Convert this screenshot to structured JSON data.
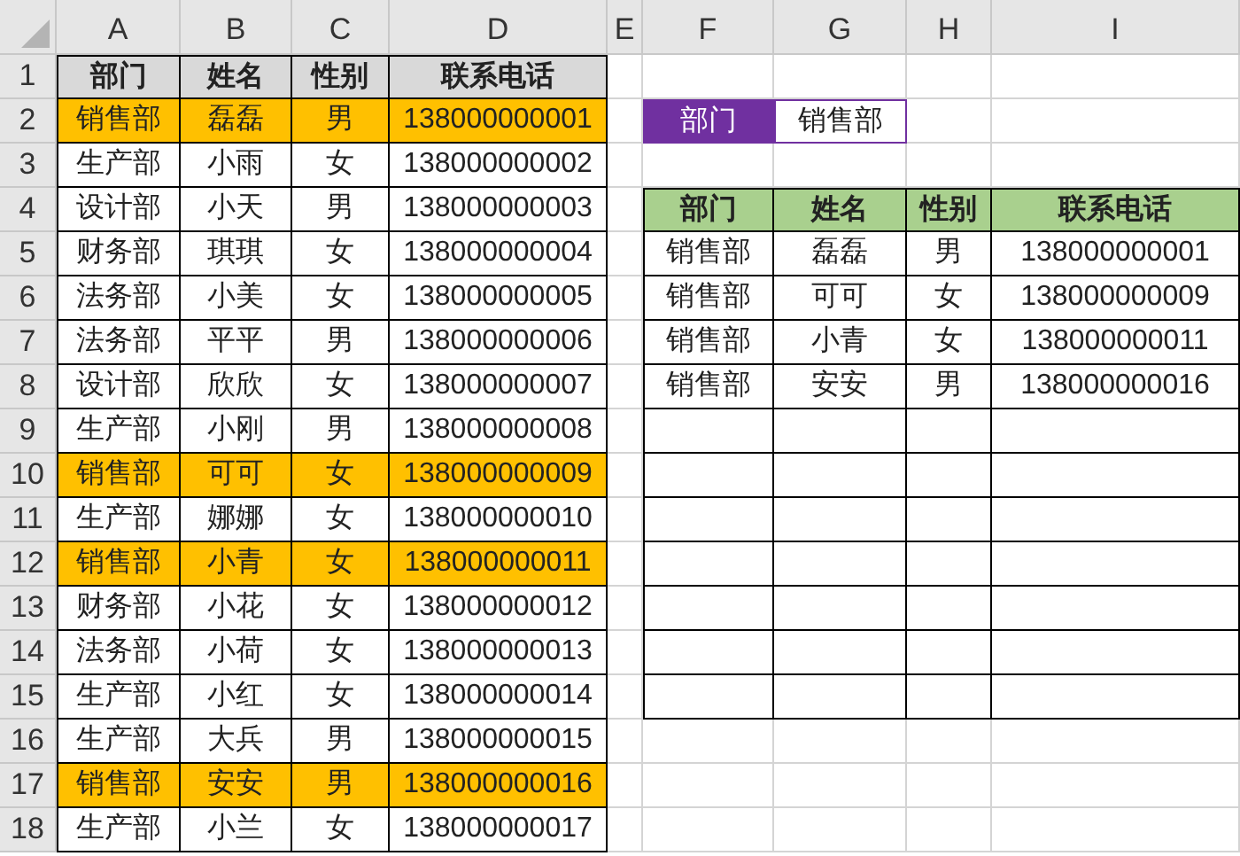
{
  "column_headers": [
    "A",
    "B",
    "C",
    "D",
    "E",
    "F",
    "G",
    "H",
    "I"
  ],
  "row_numbers": [
    "1",
    "2",
    "3",
    "4",
    "5",
    "6",
    "7",
    "8",
    "9",
    "10",
    "11",
    "12",
    "13",
    "14",
    "15",
    "16",
    "17",
    "18"
  ],
  "source_table": {
    "columns": [
      "部门",
      "姓名",
      "性别",
      "联系电话"
    ],
    "rows": [
      {
        "cells": [
          "销售部",
          "磊磊",
          "男",
          "138000000001"
        ],
        "highlighted": true
      },
      {
        "cells": [
          "生产部",
          "小雨",
          "女",
          "138000000002"
        ],
        "highlighted": false
      },
      {
        "cells": [
          "设计部",
          "小天",
          "男",
          "138000000003"
        ],
        "highlighted": false
      },
      {
        "cells": [
          "财务部",
          "琪琪",
          "女",
          "138000000004"
        ],
        "highlighted": false
      },
      {
        "cells": [
          "法务部",
          "小美",
          "女",
          "138000000005"
        ],
        "highlighted": false
      },
      {
        "cells": [
          "法务部",
          "平平",
          "男",
          "138000000006"
        ],
        "highlighted": false
      },
      {
        "cells": [
          "设计部",
          "欣欣",
          "女",
          "138000000007"
        ],
        "highlighted": false
      },
      {
        "cells": [
          "生产部",
          "小刚",
          "男",
          "138000000008"
        ],
        "highlighted": false
      },
      {
        "cells": [
          "销售部",
          "可可",
          "女",
          "138000000009"
        ],
        "highlighted": true
      },
      {
        "cells": [
          "生产部",
          "娜娜",
          "女",
          "138000000010"
        ],
        "highlighted": false
      },
      {
        "cells": [
          "销售部",
          "小青",
          "女",
          "138000000011"
        ],
        "highlighted": true
      },
      {
        "cells": [
          "财务部",
          "小花",
          "女",
          "138000000012"
        ],
        "highlighted": false
      },
      {
        "cells": [
          "法务部",
          "小荷",
          "女",
          "138000000013"
        ],
        "highlighted": false
      },
      {
        "cells": [
          "生产部",
          "小红",
          "女",
          "138000000014"
        ],
        "highlighted": false
      },
      {
        "cells": [
          "生产部",
          "大兵",
          "男",
          "138000000015"
        ],
        "highlighted": false
      },
      {
        "cells": [
          "销售部",
          "安安",
          "男",
          "138000000016"
        ],
        "highlighted": true
      },
      {
        "cells": [
          "生产部",
          "小兰",
          "女",
          "138000000017"
        ],
        "highlighted": false
      }
    ]
  },
  "criteria": {
    "label": "部门",
    "value": "销售部"
  },
  "result_table": {
    "columns": [
      "部门",
      "姓名",
      "性别",
      "联系电话"
    ],
    "rows": [
      {
        "cells": [
          "销售部",
          "磊磊",
          "男",
          "138000000001"
        ]
      },
      {
        "cells": [
          "销售部",
          "可可",
          "女",
          "138000000009"
        ]
      },
      {
        "cells": [
          "销售部",
          "小青",
          "女",
          "138000000011"
        ]
      },
      {
        "cells": [
          "销售部",
          "安安",
          "男",
          "138000000016"
        ]
      }
    ]
  }
}
